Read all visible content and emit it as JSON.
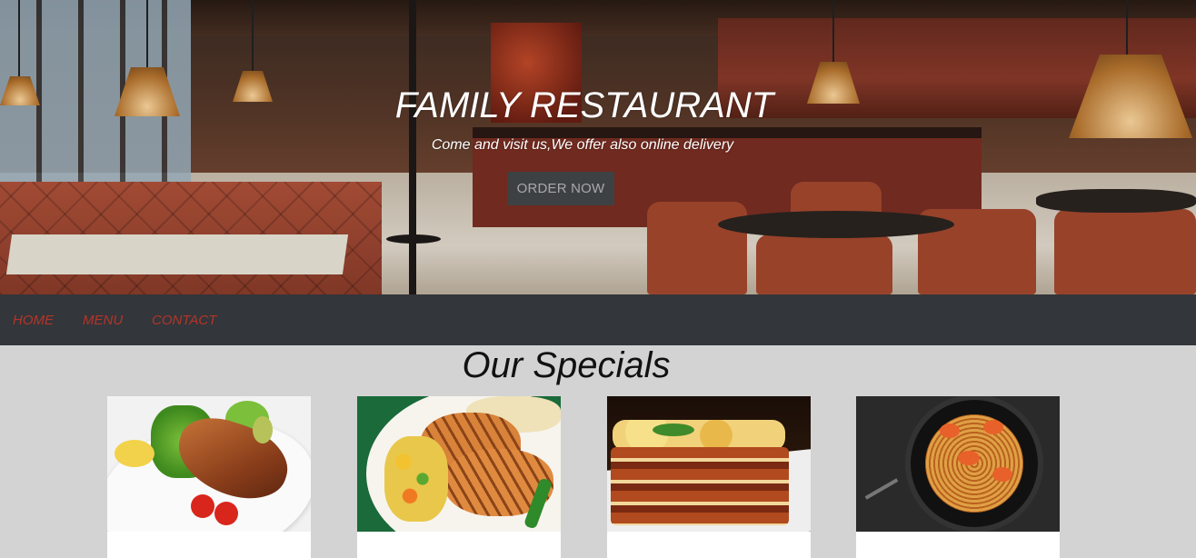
{
  "hero": {
    "title": "FAMILY RESTAURANT",
    "subtitle": "Come and visit us,We offer also online delivery",
    "button_label": "ORDER NOW"
  },
  "nav": {
    "items": [
      {
        "label": "HOME"
      },
      {
        "label": "MENU"
      },
      {
        "label": "CONTACT"
      }
    ]
  },
  "specials": {
    "title": "Our Specials",
    "cards": [
      {
        "image": "grilled-salmon-salad",
        "caption": ""
      },
      {
        "image": "grilled-chicken-vegetables",
        "caption": ""
      },
      {
        "image": "lasagna",
        "caption": ""
      },
      {
        "image": "shrimp-spaghetti",
        "caption": ""
      }
    ]
  },
  "colors": {
    "page_bg": "#d3d3d3",
    "nav_bg": "#33363a",
    "nav_link": "#b5342a",
    "button_bg": "#3e4144",
    "button_text": "#a8a8a8"
  }
}
